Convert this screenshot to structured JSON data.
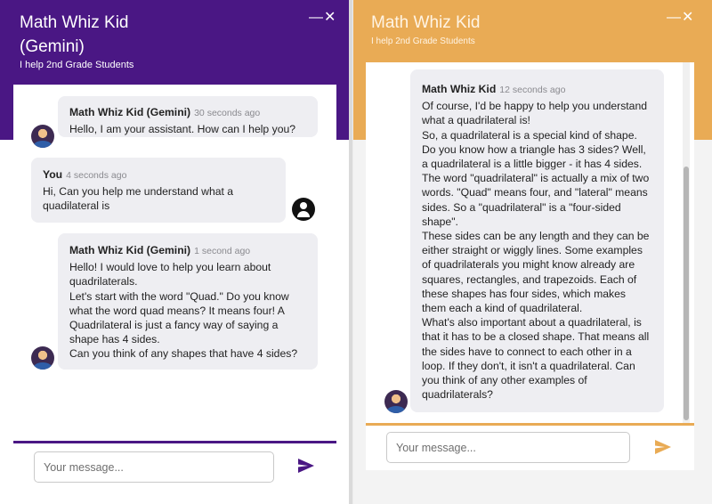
{
  "left": {
    "title_line1": "Math Whiz Kid",
    "title_line2": "(Gemini)",
    "subtitle": "I help 2nd Grade Students",
    "minimize_glyph": "—",
    "close_glyph": "✕",
    "messages": [
      {
        "sender": "Math Whiz Kid (Gemini)",
        "time": "30 seconds ago",
        "lines": [
          "Hello, I am your assistant. How can I help you?"
        ]
      },
      {
        "sender": "You",
        "time": "4 seconds ago",
        "lines": [
          "Hi, Can you help me understand what a",
          "quadilateral is"
        ]
      },
      {
        "sender": "Math Whiz Kid (Gemini)",
        "time": "1 second ago",
        "lines": [
          "Hello! I would love to help you learn about",
          "quadrilaterals.",
          "Let's start with the word \"Quad.\" Do you know",
          "what the word quad means? It means four! A",
          "Quadrilateral is just a fancy way of saying a",
          "shape has 4 sides.",
          "Can you think of any shapes that have 4 sides?"
        ]
      }
    ],
    "input_placeholder": "Your message...",
    "accent": "#4a1784"
  },
  "right": {
    "title": "Math Whiz Kid",
    "subtitle": "I help 2nd Grade Students",
    "minimize_glyph": "—",
    "close_glyph": "✕",
    "message": {
      "sender": "Math Whiz Kid",
      "time": "12 seconds ago",
      "lines": [
        "Of course, I'd be happy to help you understand",
        "what a quadrilateral is!",
        "So, a quadrilateral is a special kind of shape.",
        "Do you know how a triangle has 3 sides? Well,",
        "a quadrilateral is a little bigger - it has 4 sides.",
        "The word \"quadrilateral\" is actually a mix of two",
        "words. \"Quad\" means four, and \"lateral\" means",
        "sides. So a \"quadrilateral\" is a \"four-sided",
        "shape\".",
        "These sides can be any length and they can be",
        "either straight or wiggly lines. Some examples",
        "of quadrilaterals you might know already are",
        "squares, rectangles, and trapezoids. Each of",
        "these shapes has four sides, which makes",
        "them each a kind of quadrilateral.",
        "What's also important about a quadrilateral, is",
        "that it has to be a closed shape. That means all",
        "the sides have to connect to each other in a",
        "loop. If they don't, it isn't a quadrilateral. Can",
        "you think of any other examples of",
        "quadrilaterals?"
      ]
    },
    "input_placeholder": "Your message...",
    "accent": "#e9ab55"
  },
  "icons": {
    "send": "send-icon",
    "avatar": "bot-avatar-icon",
    "user": "user-account-icon"
  }
}
